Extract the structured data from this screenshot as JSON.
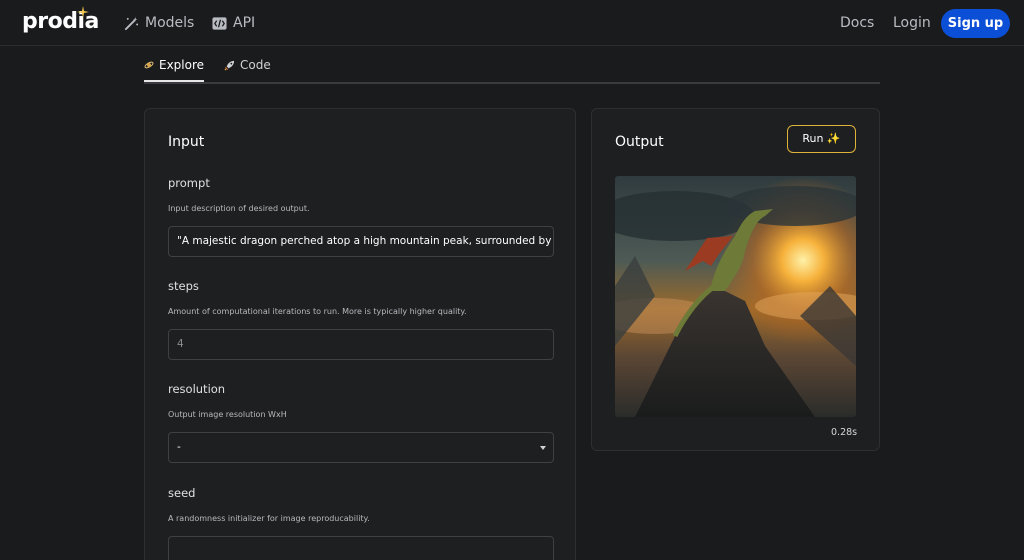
{
  "nav": {
    "logo": "prodia",
    "models": "Models",
    "api": "API",
    "docs": "Docs",
    "login": "Login",
    "signup": "Sign up"
  },
  "tabs": [
    {
      "label": "Explore",
      "icon": "orbit-icon",
      "active": true
    },
    {
      "label": "Code",
      "icon": "rocket-icon",
      "active": false
    }
  ],
  "input_panel": {
    "title": "Input",
    "fields": [
      {
        "label": "prompt",
        "description": "Input description of desired output.",
        "value": "\"A majestic dragon perched atop a high mountain peak, surrounded by swirling clouds\""
      },
      {
        "label": "steps",
        "description": "Amount of computational iterations to run. More is typically higher quality.",
        "placeholder": "4"
      },
      {
        "label": "resolution",
        "description": "Output image resolution WxH",
        "value": "-"
      },
      {
        "label": "seed",
        "description": "A randomness initializer for image reproducability.",
        "value": ""
      }
    ]
  },
  "output_panel": {
    "title": "Output",
    "run_label": "Run ✨",
    "time": "0.28s"
  },
  "colors": {
    "background": "#1a1b1d",
    "accent": "#0b4fd6",
    "run_border": "#e1b23a"
  }
}
